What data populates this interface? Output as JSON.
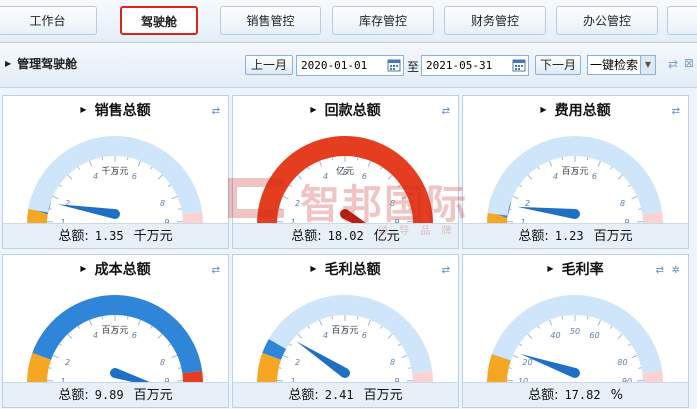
{
  "tabs": [
    {
      "label": "工作台",
      "active": false
    },
    {
      "label": "驾驶舱",
      "active": true
    },
    {
      "label": "销售管控",
      "active": false
    },
    {
      "label": "库存管控",
      "active": false
    },
    {
      "label": "财务管控",
      "active": false
    },
    {
      "label": "办公管控",
      "active": false
    }
  ],
  "toolbar": {
    "title": "管理驾驶舱",
    "prev_month": "上一月",
    "start_date": "2020-01-01",
    "to_label": "至",
    "end_date": "2021-05-31",
    "next_month": "下一月",
    "search_select": "一键检索",
    "icons": [
      "refresh-icon",
      "close-icon"
    ]
  },
  "watermark": {
    "text": "智邦国际",
    "sub": "领 导 品 牌"
  },
  "total_label": "总额:",
  "panels": [
    {
      "id": "sales",
      "title": "销售总额",
      "unit_center": "千万元",
      "value": 1.35,
      "value_text": "1.35",
      "unit": "千万元",
      "ticks": [
        "0",
        "1",
        "2",
        "4",
        "5",
        "6",
        "8",
        "9",
        "10"
      ],
      "max": 10,
      "needle": 1.35,
      "arc": "normal",
      "icons": [
        "refresh-icon"
      ]
    },
    {
      "id": "collection",
      "title": "回款总额",
      "unit_center": "亿元",
      "value": 18.02,
      "value_text": "18.02",
      "unit": "亿元",
      "ticks": [
        "0",
        "1",
        "2",
        "4",
        "5",
        "6",
        "8",
        "9",
        "10"
      ],
      "max": 10,
      "needle": 10.5,
      "arc": "red",
      "icons": [
        "refresh-icon"
      ]
    },
    {
      "id": "expense",
      "title": "费用总额",
      "unit_center": "百万元",
      "value": 1.23,
      "value_text": "1.23",
      "unit": "百万元",
      "ticks": [
        "0",
        "1",
        "2",
        "4",
        "5",
        "6",
        "8",
        "9",
        "10"
      ],
      "max": 10,
      "needle": 1.23,
      "arc": "normal",
      "icons": [
        "refresh-icon"
      ]
    },
    {
      "id": "cost",
      "title": "成本总额",
      "unit_center": "百万元",
      "value": 9.89,
      "value_text": "9.89",
      "unit": "百万元",
      "ticks": [
        "0",
        "1",
        "2",
        "4",
        "5",
        "6",
        "8",
        "9",
        "10"
      ],
      "max": 10,
      "needle": 9.89,
      "arc": "blue",
      "icons": [
        "refresh-icon"
      ]
    },
    {
      "id": "gross_profit",
      "title": "毛利总额",
      "unit_center": "百万元",
      "value": 2.41,
      "value_text": "2.41",
      "unit": "百万元",
      "ticks": [
        "0",
        "1",
        "2",
        "4",
        "5",
        "6",
        "8",
        "9",
        "10"
      ],
      "max": 10,
      "needle": 2.41,
      "arc": "normal",
      "icons": [
        "refresh-icon"
      ]
    },
    {
      "id": "gross_margin",
      "title": "毛利率",
      "unit_center": "",
      "value": 17.82,
      "value_text": "17.82",
      "unit": "%",
      "ticks": [
        "0",
        "10",
        "20",
        "40",
        "50",
        "60",
        "80",
        "90",
        "100"
      ],
      "max": 100,
      "needle": 17.82,
      "arc": "normal",
      "icons": [
        "refresh-icon",
        "gear-icon"
      ]
    }
  ],
  "colors": {
    "green_band": "#f5a623",
    "blue_band": "#2f86d9",
    "light_band": "#cfe6fa",
    "red_band": "#e53d1f",
    "pink_band": "#fbd2d2",
    "needle": "#1f6fc5",
    "tick_text": "#5f7fa6"
  }
}
